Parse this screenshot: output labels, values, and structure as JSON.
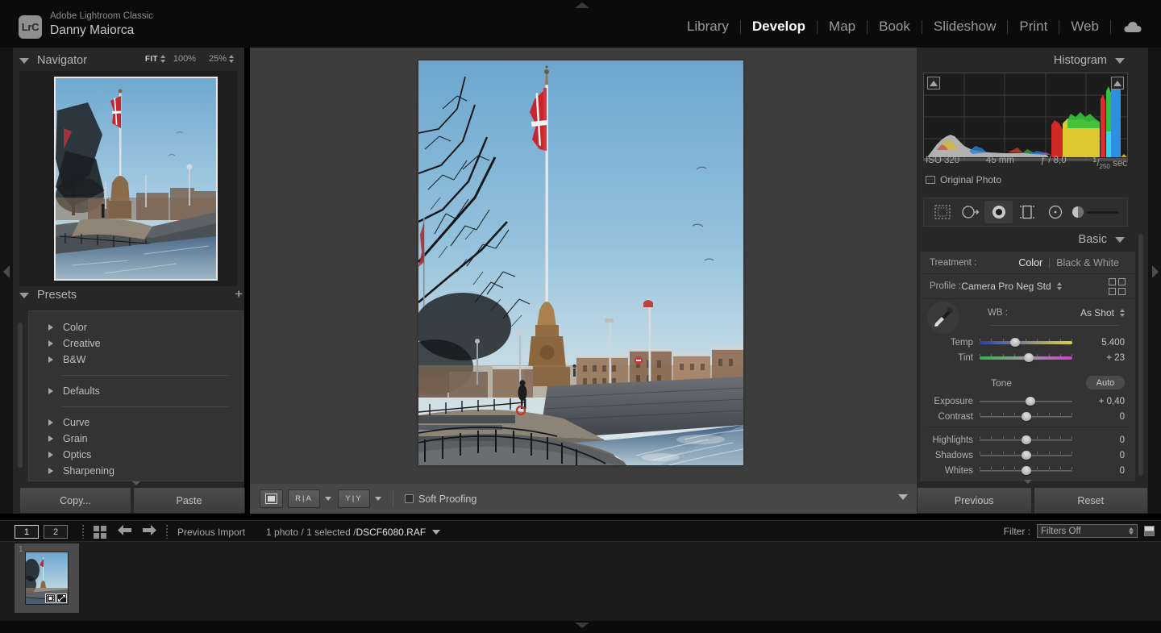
{
  "app": {
    "logo_text": "LrC",
    "product_name": "Adobe Lightroom Classic",
    "user_name": "Danny Maiorca"
  },
  "modules": [
    {
      "label": "Library",
      "active": false
    },
    {
      "label": "Develop",
      "active": true
    },
    {
      "label": "Map",
      "active": false
    },
    {
      "label": "Book",
      "active": false
    },
    {
      "label": "Slideshow",
      "active": false
    },
    {
      "label": "Print",
      "active": false
    },
    {
      "label": "Web",
      "active": false
    }
  ],
  "navigator": {
    "title": "Navigator",
    "zoom_fit": "FIT",
    "zoom_100": "100%",
    "zoom_25": "25%"
  },
  "presets": {
    "title": "Presets",
    "add_label": "+",
    "groups": [
      {
        "type": "item",
        "label": "Color"
      },
      {
        "type": "item",
        "label": "Creative"
      },
      {
        "type": "item",
        "label": "B&W"
      },
      {
        "type": "divider"
      },
      {
        "type": "item",
        "label": "Defaults"
      },
      {
        "type": "divider"
      },
      {
        "type": "item",
        "label": "Curve"
      },
      {
        "type": "item",
        "label": "Grain"
      },
      {
        "type": "item",
        "label": "Optics"
      },
      {
        "type": "item",
        "label": "Sharpening"
      }
    ]
  },
  "left_buttons": {
    "copy": "Copy...",
    "paste": "Paste"
  },
  "toolbar": {
    "loupe_view": "loupe-view",
    "before_after_lr": "R|A",
    "before_after_tb": "Y|Y",
    "soft_proofing_label": "Soft Proofing",
    "soft_proofing_checked": false
  },
  "histogram": {
    "title": "Histogram",
    "iso": "ISO 320",
    "focal_length": "45 mm",
    "aperture": "ƒ / 8,0",
    "shutter": "sec",
    "shutter_fraction_num": "1",
    "shutter_fraction_den": "250",
    "original_photo_label": "Original Photo"
  },
  "tools": [
    {
      "name": "crop-overlay-tool"
    },
    {
      "name": "spot-removal-tool"
    },
    {
      "name": "masking-tool"
    },
    {
      "name": "linear-gradient-tool"
    },
    {
      "name": "radial-gradient-tool"
    },
    {
      "name": "adjustment-brush-tool"
    }
  ],
  "basic": {
    "title": "Basic",
    "treatment_label": "Treatment :",
    "treatment_color": "Color",
    "treatment_bw": "Black & White",
    "treatment_selected": "Color",
    "profile_label": "Profile :",
    "profile_value": "Camera Pro Neg Std",
    "wb_label": "WB :",
    "wb_value": "As Shot",
    "white_balance": [
      {
        "name": "Temp",
        "value": "5.400",
        "pos": 38,
        "gradient": "linear-gradient(90deg,#2b3fa8,#8f8f8f,#d8d33c)"
      },
      {
        "name": "Tint",
        "value": "+ 23",
        "pos": 53,
        "gradient": "linear-gradient(90deg,#36b24a,#9a9a9a,#cc3ecc)"
      }
    ],
    "tone_label": "Tone",
    "auto_label": "Auto",
    "tone_sliders": [
      {
        "name": "Exposure",
        "value": "+ 0,40",
        "pos": 55
      },
      {
        "name": "Contrast",
        "value": "0",
        "pos": 50
      }
    ],
    "tone_sliders2": [
      {
        "name": "Highlights",
        "value": "0",
        "pos": 50
      },
      {
        "name": "Shadows",
        "value": "0",
        "pos": 50
      },
      {
        "name": "Whites",
        "value": "0",
        "pos": 50
      }
    ]
  },
  "right_buttons": {
    "previous": "Previous",
    "reset": "Reset"
  },
  "filmstrip": {
    "monitor_1": "1",
    "monitor_2": "2",
    "source_label": "Previous Import",
    "selection_text": "1 photo / 1 selected / ",
    "filename": "DSCF6080.RAF",
    "filter_label": "Filter :",
    "filter_value": "Filters Off",
    "thumb_index": "1"
  },
  "colors": {
    "panel_bg": "#272727",
    "center_bg": "#3d3d3d",
    "accent_text": "#ffffff",
    "sky": "#7fb6d8",
    "flag_red": "#c8262f"
  }
}
